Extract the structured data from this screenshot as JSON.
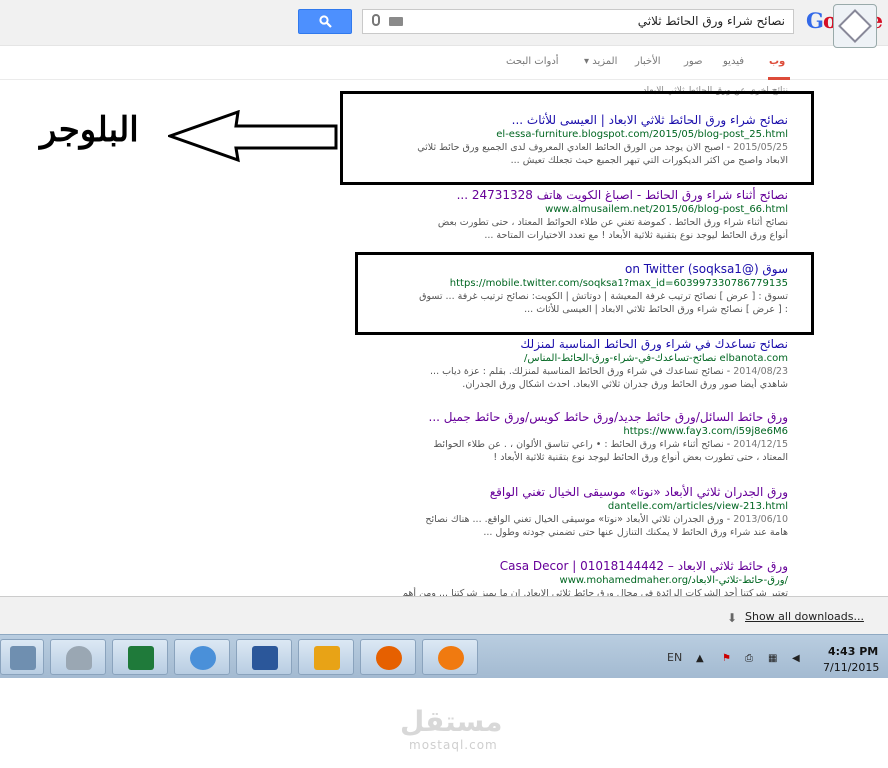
{
  "search": {
    "query": "نصائح شراء ورق الحائط ثلاثي",
    "button_label": ""
  },
  "logo": {
    "g1": "G",
    "o1": "o",
    "o2": "o",
    "g2": "g",
    "l": "l",
    "e": "e"
  },
  "tabs": [
    {
      "label": "وب",
      "active": true
    },
    {
      "label": "فيديو"
    },
    {
      "label": "صور"
    },
    {
      "label": "الأخبار"
    },
    {
      "label": "المزيد ▾"
    },
    {
      "label": "أدوات البحث"
    }
  ],
  "partial_top": "نتائج أخرى عن ورق الحائط ثلاثي الأبعاد",
  "annotation_label": "البلوجر",
  "results": [
    {
      "title": "نصائح شراء ورق الحائط ثلاثي الابعاد | العيسى للأثاث ...",
      "url": "el-essa-furniture.blogspot.com/2015/05/blog-post_25.html",
      "date": "2015/05/25",
      "snippet1": " - اصبح الان يوجد من الورق الحائط العادي المعروف لدى الجميع ورق حائط ثلاثي",
      "snippet2": "الابعاد واصبح من اكثر الديكورات التي تبهر الجميع حيث تجعلك تعيش ..."
    },
    {
      "title": "نصائح أثناء شراء ورق الحائط - اصباغ الكويت هاتف 24731328 ...",
      "url": "www.almusailem.net/2015/06/blog-post_66.html",
      "date": "",
      "snippet1": "نصائح أثناء شراء ورق الحائط . كموضة تغني عن طلاء الحوائط المعتاد ، حتى تطورت بعض",
      "snippet2": "أنواع ورق الحائط ليوجد نوع بتقنية ثلاثية الأبعاد ! مع تعدد الاختيارات المتاحة ..."
    },
    {
      "title": "سوق (@soqksa1) on Twitter",
      "url": "https://mobile.twitter.com/soqksa1?max_id=603997330786779135",
      "date": "",
      "snippet1": "تسوق : [ عرض ] نصائح ترتيب غرفة المعيشة | دوتاتش | الكويت: نصائح ترتيب غرفة ... تسوق",
      "snippet2": ": [ عرض ] نصائح شراء ورق الحائط ثلاثي الابعاد | العيسى للأثاث ..."
    },
    {
      "title": "نصائح تساعدك في شراء ورق الحائط المناسبة لمنزلك",
      "url": "/نصائح-تساعدك-في-شراء-ورق-الحائط-المناس elbanota.com",
      "date": "2014/08/23",
      "snippet1": " - نصائح تساعدك في شراء ورق الحائط المناسبة لمنزلك. بقلم : عزة دياب ...",
      "snippet2": "شاهدي أيضا صور ورق الحائط ورق جدران ثلاثي الابعاد. احدث اشكال ورق الجدران."
    },
    {
      "title": "ورق حائط السائل/ورق حائط جديد/ورق حائط كويس/ورق حائط جميل ...",
      "url": "https://www.fay3.com/i59j8e6M6",
      "date": "2014/12/15",
      "snippet1": " - نصائح أثناء شراء ورق الحائط : • راعي تناسق الألوان ، . عن طلاء الحوائط",
      "snippet2": "المعتاد ، حتى تطورت بعض أنواع ورق الحائط ليوجد نوع بتقنية ثلاثية الأبعاد !"
    },
    {
      "title": "ورق الجدران ثلاثي الأبعاد «نوتا» موسيقى الخيال تغني الواقع",
      "url": "dantelle.com/articles/view-213.html",
      "date": "2013/06/10",
      "snippet1": " - ورق الجدران ثلاثي الأبعاد «نوتا» موسيقى الخيال تغني الواقع. ... هناك نصائح",
      "snippet2": "هامة عند شراء ورق الحائط لا يمكنك التنازل عنها حتى تضمني جودته وطول ..."
    },
    {
      "title": "ورق حائط ثلاثي الابعاد – Casa Decor | 01018144442",
      "url": "www.mohamedmaher.org/ورق-حائط-ثلاثي-الابعاد/",
      "date": "",
      "snippet1": "تعتبر شركتنا أحد الشركات الرائدة في مجال ورق حائط ثلاثي الابعاد. إن ما يميز شركتنا ... ومن أهم",
      "snippet2": ""
    }
  ],
  "downloads": {
    "label": "Show all downloads..."
  },
  "taskbar": {
    "apps": [
      "network-icon",
      "recycle-icon",
      "excel-icon",
      "paint-icon",
      "word-icon",
      "outlook-icon",
      "firefox-icon",
      "avast-icon"
    ],
    "lang": "EN",
    "time": "4:43 PM",
    "date": "7/11/2015"
  },
  "watermark": {
    "logo": "مستقل",
    "text": "mostaql.com"
  }
}
